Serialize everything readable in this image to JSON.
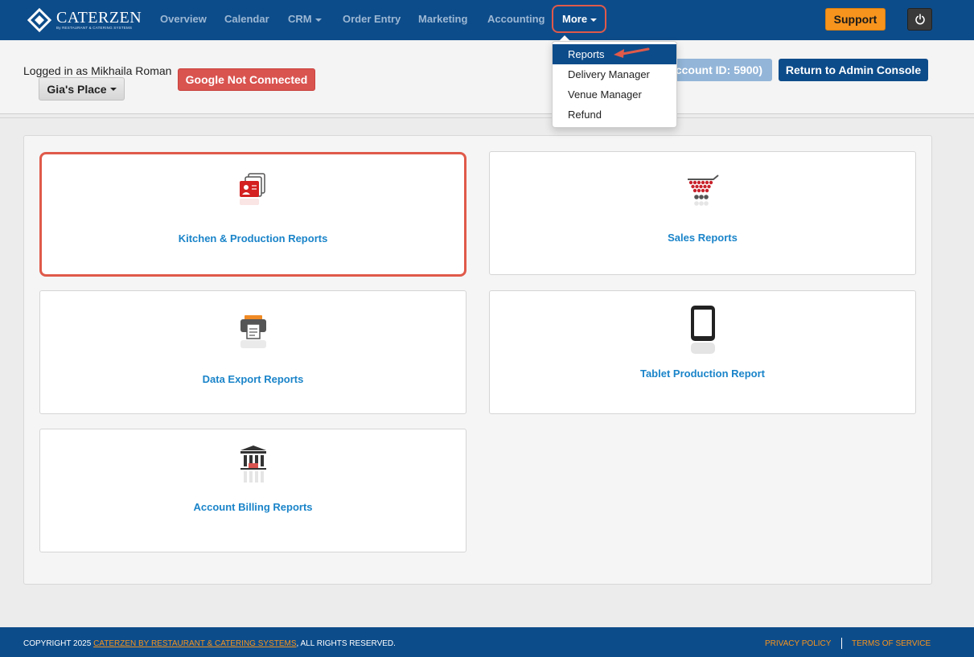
{
  "brand": {
    "name": "CATERZEN",
    "tagline": "By RESTAURANT & CATERING SYSTEMS",
    "primary_color": "#0d4c8a",
    "accent_color": "#f7941d"
  },
  "nav": {
    "overview": "Overview",
    "calendar": "Calendar",
    "crm": "CRM",
    "order_entry": "Order Entry",
    "marketing": "Marketing",
    "accounting": "Accounting",
    "more": "More",
    "support": "Support",
    "power_icon": "power-icon"
  },
  "more_menu": {
    "items": [
      {
        "label": "Reports",
        "active": true
      },
      {
        "label": "Delivery Manager"
      },
      {
        "label": "Venue Manager"
      },
      {
        "label": "Refund"
      }
    ]
  },
  "subheader": {
    "logged_in": "Logged in as Mikhaila Roman",
    "venue": "Gia's Place",
    "google_status": "Google Not Connected",
    "account_id": "Account ID: 5900)",
    "return_admin": "Return to Admin Console"
  },
  "reports": [
    {
      "label": "Kitchen & Production Reports",
      "icon": "kitchen-report-icon"
    },
    {
      "label": "Sales Reports",
      "icon": "shopping-cart-icon"
    },
    {
      "label": "Data Export Reports",
      "icon": "printer-icon"
    },
    {
      "label": "Tablet Production Report",
      "icon": "tablet-icon"
    },
    {
      "label": "Account Billing Reports",
      "icon": "bank-icon"
    }
  ],
  "footer": {
    "copyright_prefix": "COPYRIGHT 2025",
    "copyright_link": "CATERZEN BY RESTAURANT & CATERING SYSTEMS",
    "copyright_suffix": ", ALL RIGHTS RESERVED.",
    "privacy": "PRIVACY POLICY",
    "terms": "TERMS OF SERVICE"
  }
}
